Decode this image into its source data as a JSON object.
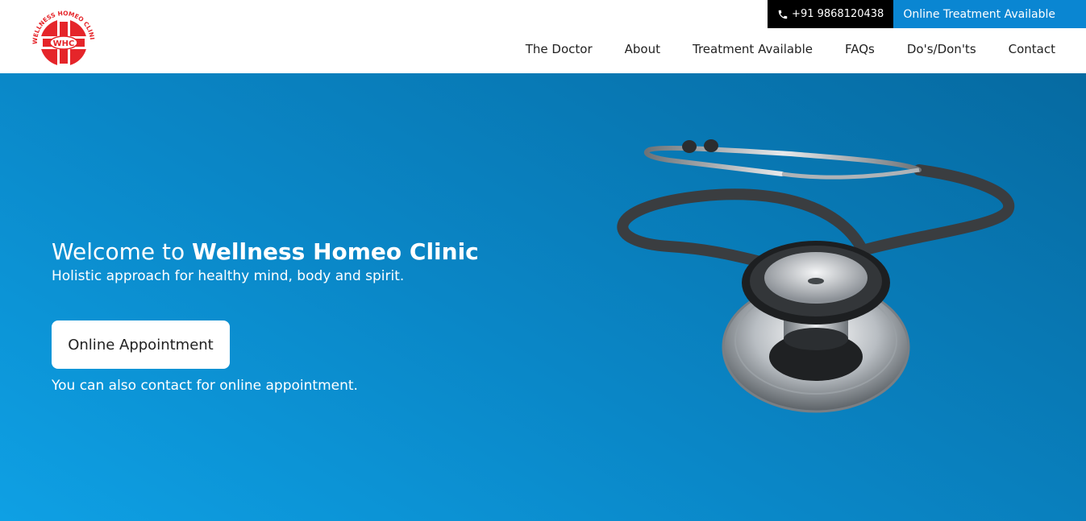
{
  "logo": {
    "arc_text": "WELLNESS HOMEO CLINIC",
    "badge_text": "WHC",
    "brand_color": "#e5252a"
  },
  "topbar": {
    "phone_icon": "phone-icon",
    "phone": "+91 9868120438",
    "online_label": "Online Treatment Available",
    "online_bg": "#0a86d2"
  },
  "nav": {
    "items": [
      "The Doctor",
      "About",
      "Treatment Available",
      "FAQs",
      "Do's/Don'ts",
      "Contact"
    ]
  },
  "hero": {
    "welcome_prefix": "Welcome to ",
    "welcome_brand": "Wellness Homeo Clinic",
    "tagline": "Holistic approach for healthy mind, body and spirit.",
    "button_label": "Online Appointment",
    "contact_note": "You can also contact for online appointment.",
    "image": "stethoscope-image"
  }
}
